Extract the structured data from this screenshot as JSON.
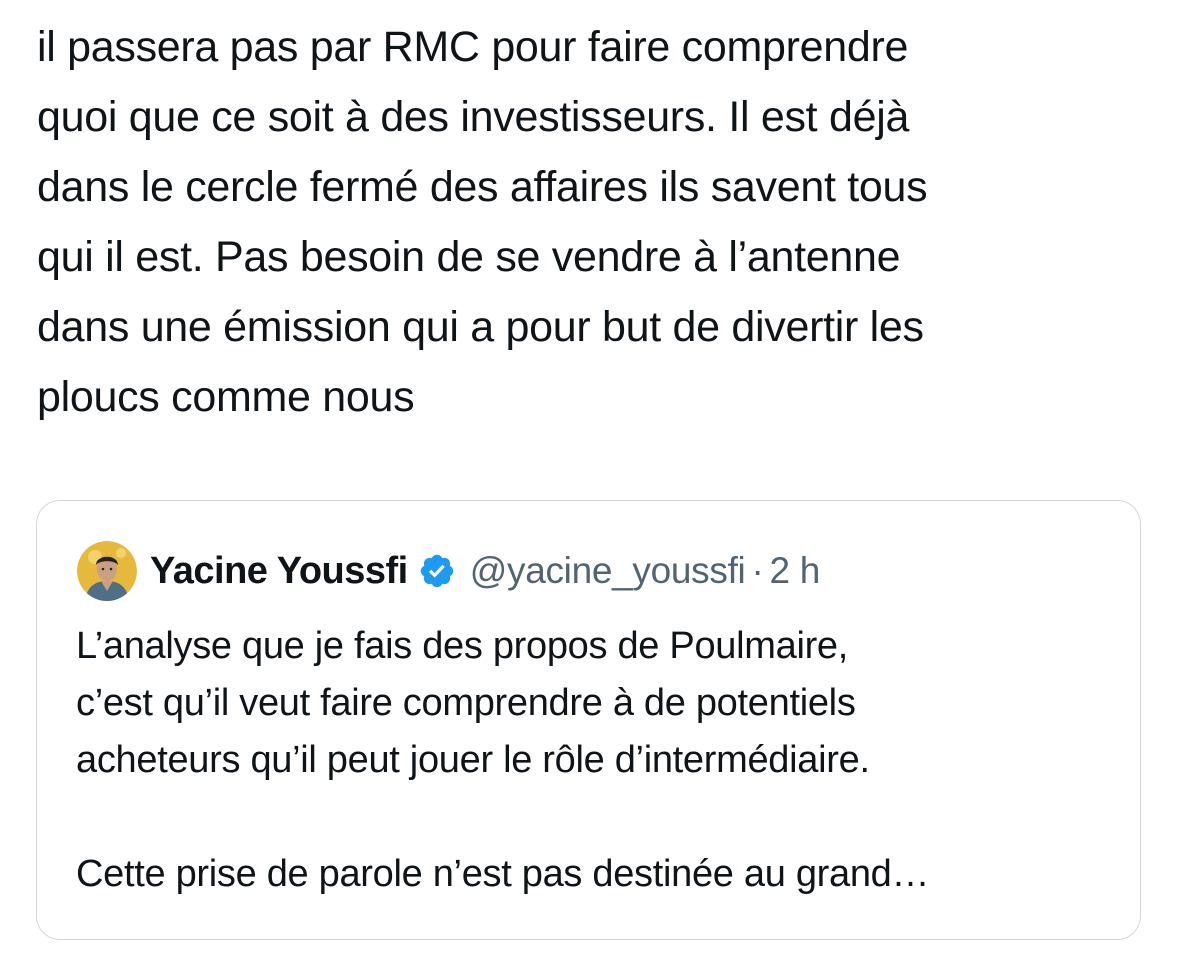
{
  "tweet": {
    "text_lines": [
      "il passera pas par RMC pour faire comprendre",
      "quoi que ce soit à des investisseurs. Il est déjà",
      "dans le cercle fermé des affaires ils savent tous",
      "qui il est. Pas besoin de se vendre à l’antenne",
      "dans une émission qui a pour but de divertir les",
      "ploucs comme nous"
    ]
  },
  "quote": {
    "author_name": "Yacine Youssfi",
    "verified_icon": "verified-badge-icon",
    "verified_color": "#1d9bf0",
    "handle": "@yacine_youssfi",
    "separator": "·",
    "time": "2 h",
    "text_lines": [
      "L’analyse que je fais des propos de Poulmaire,",
      "c’est qu’il veut faire comprendre à de potentiels",
      "acheteurs qu’il peut jouer le rôle d’intermédiaire."
    ],
    "text_truncated": "Cette prise de parole n’est pas destinée au grand…"
  },
  "colors": {
    "text": "#0f1419",
    "secondary_text": "#536471",
    "border": "#cfd9de",
    "avatar_bg": "#e6b93c"
  }
}
